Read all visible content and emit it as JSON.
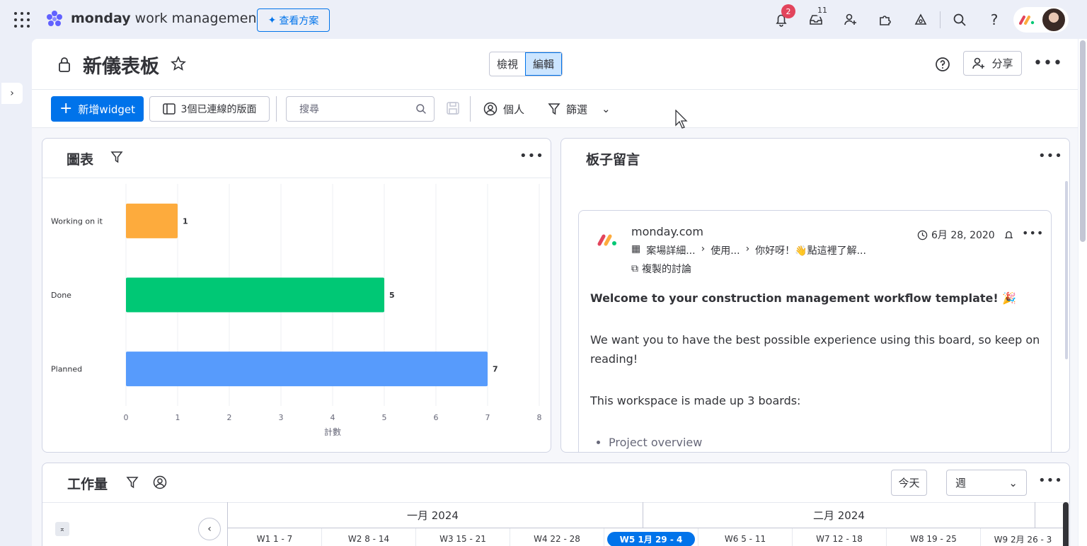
{
  "topbar": {
    "brand_bold": "monday",
    "brand_rest": " work management",
    "plans_button": "查看方案",
    "notifications_count": "2",
    "inbox_count": "11"
  },
  "board": {
    "title": "新儀表板",
    "view_mode": {
      "view": "檢視",
      "edit": "編輯",
      "selected": "編輯"
    },
    "share_label": "分享"
  },
  "toolbar": {
    "add_widget": "新增widget",
    "connected_boards": "3個已連線的版面",
    "search_placeholder": "搜尋",
    "person_label": "個人",
    "filter_label": "篩選"
  },
  "chart_widget": {
    "title": "圖表"
  },
  "chart_data": {
    "type": "bar",
    "orientation": "horizontal",
    "categories": [
      "Working on it",
      "Done",
      "Planned"
    ],
    "values": [
      1,
      5,
      7
    ],
    "colors": [
      "#fdab3d",
      "#00c875",
      "#579bfc"
    ],
    "xlabel": "計數",
    "ylabel": "",
    "xlim": [
      0,
      8
    ],
    "xticks": [
      "0",
      "1",
      "2",
      "3",
      "4",
      "5",
      "6",
      "7",
      "8"
    ],
    "grid": true,
    "data_labels": [
      "1",
      "5",
      "7"
    ]
  },
  "notes_widget": {
    "title": "板子留言",
    "author": "monday.com",
    "date": "6月 28, 2020",
    "breadcrumbs": [
      "案場詳細...",
      "使用...",
      "你好呀！👋點這裡了解..."
    ],
    "copied_label": "複製的討論",
    "heading": "Welcome to your construction management workflow template! 🎉",
    "paragraph1": "We want you to have the best possible experience using this board, so keep on reading!",
    "paragraph2": "This workspace is made up 3 boards:",
    "list": [
      "Project overview"
    ]
  },
  "workload_widget": {
    "title": "工作量",
    "today_label": "今天",
    "scale_label": "週",
    "months": [
      "一月 2024",
      "二月 2024"
    ],
    "weeks": [
      "W1 1 - 7",
      "W2 8 - 14",
      "W3 15 - 21",
      "W4 22 - 28",
      "W5 1月 29 - 4",
      "W6 5 - 11",
      "W7 12 - 18",
      "W8 19 - 25",
      "W9 2月 26 - 3"
    ],
    "current_week": "W5 1月 29 - 4"
  },
  "colors": {
    "primary": "#0073ea",
    "working": "#fdab3d",
    "done": "#00c875",
    "planned": "#579bfc",
    "badge": "#e2445c"
  }
}
